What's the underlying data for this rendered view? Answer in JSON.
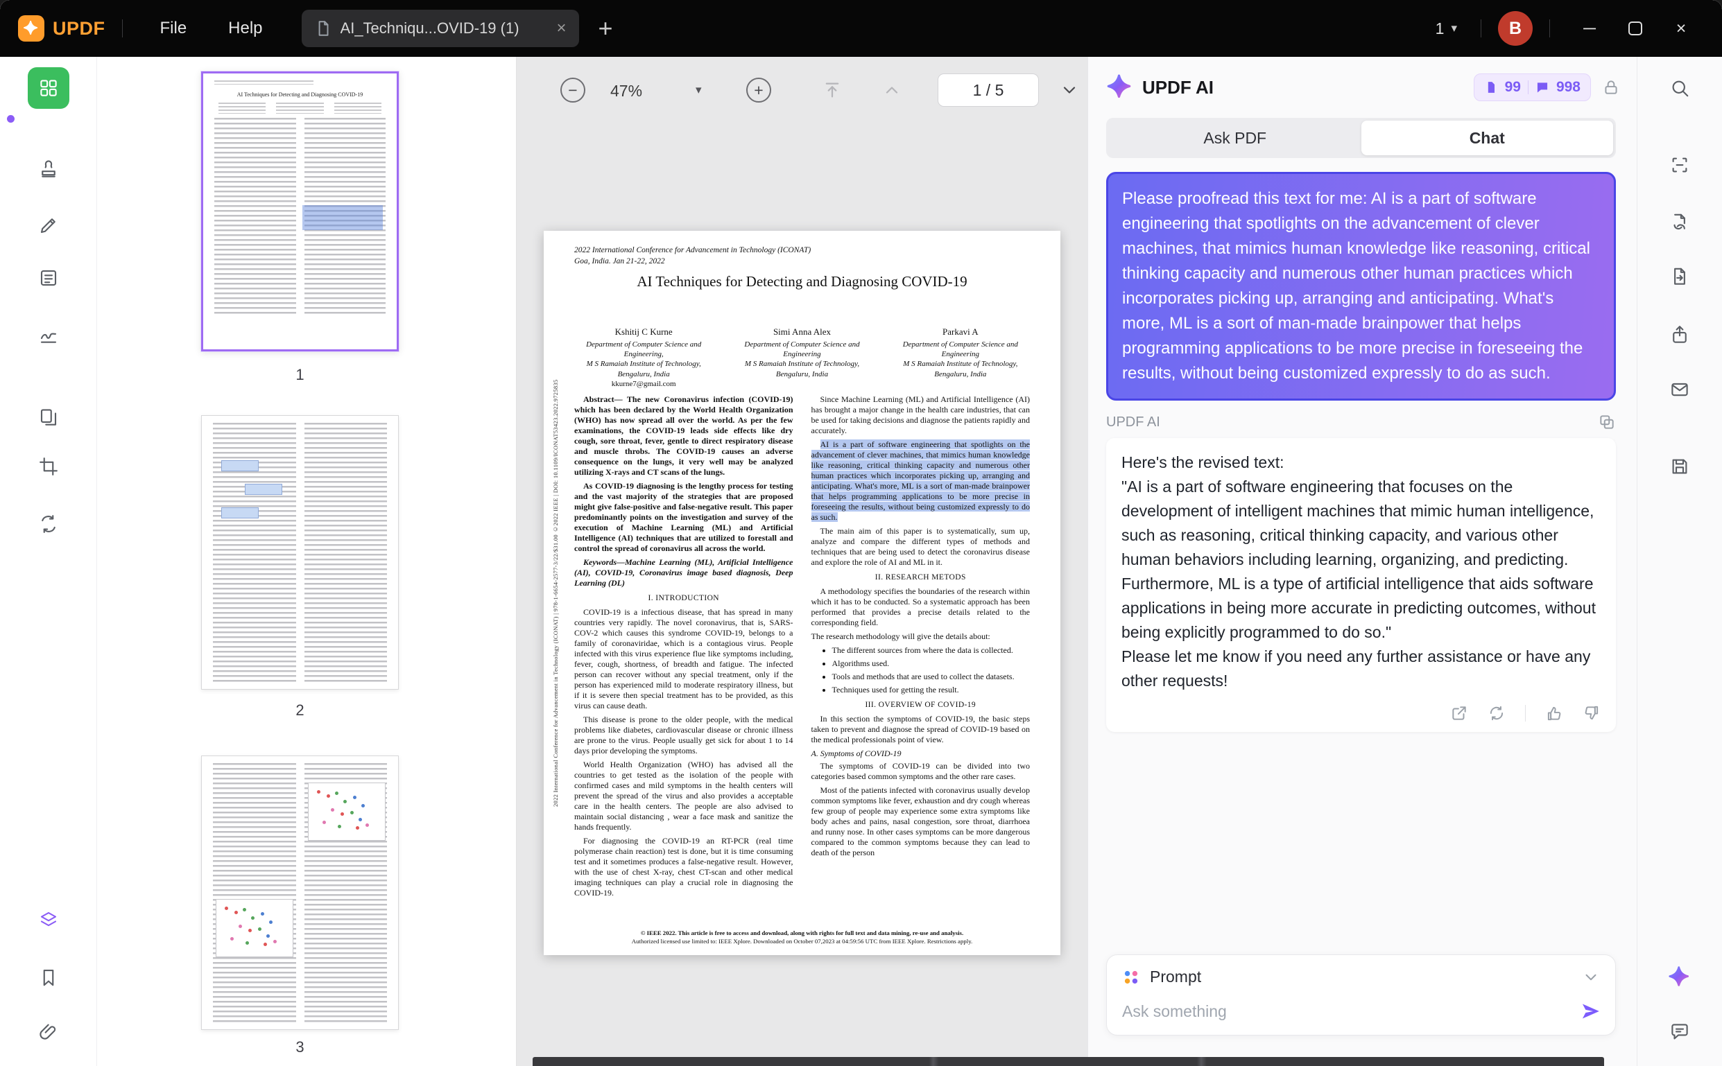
{
  "icons": {
    "close": "×",
    "plus": "+",
    "caret_down": "▾",
    "minimize": "─",
    "zoom_out": "−",
    "zoom_in": "+"
  },
  "titlebar": {
    "app_name": "UPDF",
    "menus": {
      "file": "File",
      "help": "Help"
    },
    "tab_title": "AI_Techniqu...OVID-19 (1)",
    "window_count": "1",
    "avatar_initial": "B"
  },
  "thumbnails": {
    "labels": [
      "1",
      "2",
      "3"
    ]
  },
  "toolbar": {
    "zoom_level": "47%",
    "page_indicator": "1 / 5"
  },
  "pdf": {
    "conf_line1": "2022 International Conference for Advancement in Technology (ICONAT)",
    "conf_line2": "Goa, India. Jan 21-22, 2022",
    "title": "AI Techniques for Detecting and Diagnosing COVID-19",
    "authors": [
      {
        "name": "Kshitij C Kurne",
        "dept": "Department of Computer Science and Engineering,",
        "inst": "M S Ramaiah Institute of Technology,",
        "city": "Bengaluru, India",
        "email": "kkurne7@gmail.com"
      },
      {
        "name": "Simi Anna Alex",
        "dept": "Department of Computer Science and Engineering",
        "inst": "M S Ramaiah Institute of Technology,",
        "city": "Bengaluru, India",
        "email": ""
      },
      {
        "name": "Parkavi A",
        "dept": "Department of Computer Science and Engineering",
        "inst": "M S Ramaiah Institute of Technology,",
        "city": "Bengaluru, India",
        "email": ""
      }
    ],
    "left_column": {
      "abstract": "Abstract— The new Coronavirus infection (COVID-19) which has been declared by the World Health Organization (WHO) has now spread all over the world. As per the few examinations, the COVID-19 leads side effects like dry cough, sore throat, fever, gentle to direct respiratory disease and muscle throbs. The COVID-19 causes an adverse consequence on the lungs, it very well may be analyzed utilizing X-rays and CT scans of the lungs.",
      "abstract2": "As COVID-19 diagnosing is the lengthy process for testing and the vast majority of the strategies that are proposed might give false-positive and false-negative result. This paper predominantly points on the investigation and survey of the execution of Machine Learning (ML) and Artificial Intelligence (AI) techniques that are utilized to forestall and control the spread of coronavirus all across the world.",
      "keywords": "Keywords—Machine Learning (ML), Artificial Intelligence (AI), COVID-19, Coronavirus image based diagnosis, Deep Learning (DL)",
      "sec1": "I. INTRODUCTION",
      "p1": "COVID-19 is a infectious disease, that has spread in many countries very rapidly. The novel coronavirus, that is, SARS-COV-2 which causes this syndrome COVID-19, belongs to a family of coronaviridae, which is a contagious virus. People infected with this virus experience flue like symptoms including, fever, cough, shortness, of breadth and fatigue. The infected person can recover without any special treatment, only if the person has experienced mild to moderate respiratory illness, but if it is severe then special treatment has to be provided, as this virus can cause death.",
      "p2": "This disease is prone to the older people, with the medical problems like diabetes, cardiovascular disease or chronic illness are prone to the virus. People usually get sick for about 1 to 14 days prior developing the symptoms.",
      "p3": "World Health Organization (WHO) has advised all the countries to get tested as the isolation of the people with confirmed cases and mild symptoms in the health centers will prevent the spread of the virus and also provides a acceptable care in the health centers. The people are also advised to maintain social distancing , wear a face mask and sanitize the hands frequently.",
      "p4": "For diagnosing the COVID-19 an RT-PCR (real time polymerase chain reaction) test is done, but it is time consuming test and it sometimes produces a false-negative result. However, with the use of chest X-ray, chest CT-scan and other medical imaging techniques can play a crucial role in diagnosing the COVID-19."
    },
    "right_column": {
      "p1": "Since Machine Learning (ML) and Artificial Intelligence (AI) has brought a major change in the health care industries, that can be used for taking decisions and diagnose the patients rapidly and accurately.",
      "highlighted": "AI is a part of software engineering that spotlights on the advancement of clever machines, that mimics human knowledge like reasoning, critical thinking capacity and numerous other human practices which incorporates picking up, arranging and anticipating. What's more, ML is a sort of man-made brainpower that helps programming applications to be more precise in foreseeing the results, without being customized expressly to do as such.",
      "p2": "The main aim of this paper is to systematically, sum up, analyze and compare the different types of methods and techniques that are being used to detect the coronavirus disease and explore the role of AI and ML in it.",
      "sec2": "II. RESEARCH METODS",
      "p3": "A methodology specifies the boundaries of the research within which it has to be conducted. So a systematic approach has been performed that provides a precise details related to the corresponding field.",
      "p4": "The research methodology will give the details about:",
      "bullets": [
        "The different sources from where the data is collected.",
        "Algorithms used.",
        "Tools and methods that are used to collect the datasets.",
        "Techniques used for getting the result."
      ],
      "sec3": "III. OVERVIEW OF COVID-19",
      "p5": "In this section the symptoms of COVID-19, the basic steps taken to prevent and diagnose the spread of COVID-19 based on the medical professionals point of view.",
      "subA": "A. Symptoms of COVID-19",
      "p6": "The symptoms of COVID-19 can be divided into two categories based common symptoms and the other rare cases.",
      "p7": "Most of the patients infected with coronavirus usually develop common symptoms like fever, exhaustion and dry cough whereas few group of people may experience some extra symptoms like body aches and pains, nasal congestion, sore throat, diarrhoea and runny nose. In other cases symptoms can be more dangerous compared to the common symptoms because they can lead to death of the person"
    },
    "side_text": "2022 International Conference for Advancement in Technology (ICONAT) | 978-1-6654-2577-3/22/$31.00 ©2022 IEEE | DOI: 10.1109/ICONAT53423.2022.9725835",
    "footer1": "© IEEE 2022. This article is free to access and download, along with rights for full text and data mining, re-use and analysis.",
    "footer2": "Authorized licensed use limited to: IEEE Xplore. Downloaded on October 07,2023 at 04:59:56 UTC from IEEE Xplore. Restrictions apply."
  },
  "ai_panel": {
    "title": "UPDF AI",
    "quota_doc": "99",
    "quota_chat": "998",
    "tabs": {
      "ask_pdf": "Ask PDF",
      "chat": "Chat"
    },
    "user_message": "Please proofread this text for me: AI is a part of software engineering that spotlights on the advancement of clever machines, that mimics human knowledge like reasoning, critical thinking capacity and numerous other human practices which incorporates picking up, arranging and anticipating. What's more, ML is a sort of man-made brainpower that helps programming applications to be more precise in foreseeing the results, without being customized expressly to do as such.",
    "responder_label": "UPDF AI",
    "response": {
      "line1": "Here's the revised text:",
      "line2": "\"AI is a part of software engineering that focuses on the development of intelligent machines that mimic human intelligence, such as reasoning, critical thinking capacity, and various other human behaviors including learning, organizing, and predicting. Furthermore, ML is a type of artificial intelligence that aids software applications in being more accurate in predicting outcomes, without being explicitly programmed to do so.\"",
      "line3": "Please let me know if you need any further assistance or have any other requests!"
    },
    "prompt_label": "Prompt",
    "input_placeholder": "Ask something"
  }
}
